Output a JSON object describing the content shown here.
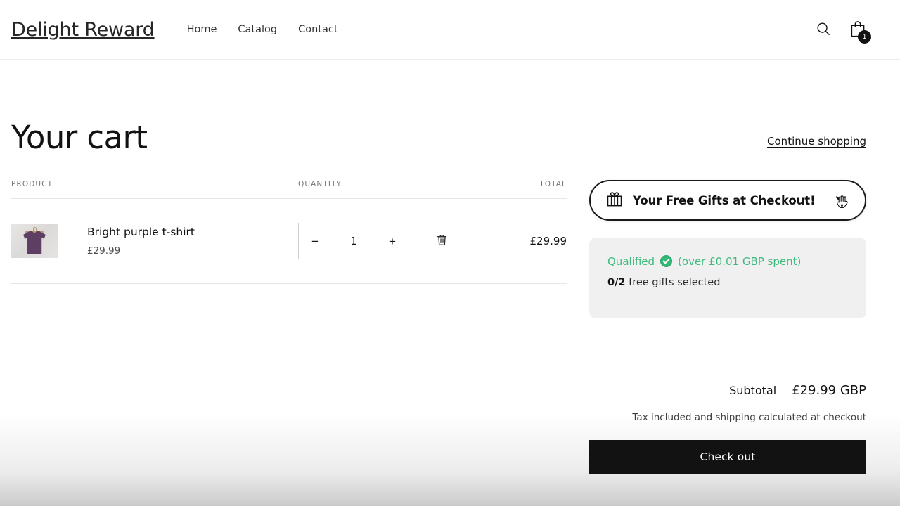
{
  "header": {
    "brand": "Delight Reward",
    "nav": [
      {
        "label": "Home"
      },
      {
        "label": "Catalog"
      },
      {
        "label": "Contact"
      }
    ],
    "search_icon": "search-icon",
    "cart_icon": "shopping-bag-icon",
    "cart_count": "1"
  },
  "cart": {
    "title": "Your cart",
    "continue_shopping": "Continue shopping",
    "columns": {
      "product": "PRODUCT",
      "quantity": "QUANTITY",
      "total": "TOTAL"
    },
    "items": [
      {
        "title": "Bright purple t-shirt",
        "price": "£29.99",
        "quantity": "1",
        "decrease_label": "−",
        "increase_label": "+",
        "remove_icon": "trash-icon",
        "line_total": "£29.99",
        "thumb_alt": "purple-t-shirt-thumbnail"
      }
    ]
  },
  "gift_banner": {
    "icon": "gift-icon",
    "label": "Your Free Gifts at Checkout!",
    "toggle_icon": "chevron-down-icon",
    "cursor_icon": "hand-pointer-cursor",
    "border_color": "#1a1a1a"
  },
  "qualified": {
    "status": "Qualified",
    "status_icon": "check-circle-icon",
    "condition": "(over £0.01 GBP spent)",
    "selected_count": "0/2",
    "selected_suffix": "free gifts selected",
    "accent_color": "#3fba7e",
    "panel_color": "#f0f0f0"
  },
  "totals": {
    "subtotal_label": "Subtotal",
    "subtotal_value": "£29.99 GBP",
    "tax_note": "Tax included and shipping calculated at checkout",
    "checkout_label": "Check out"
  }
}
